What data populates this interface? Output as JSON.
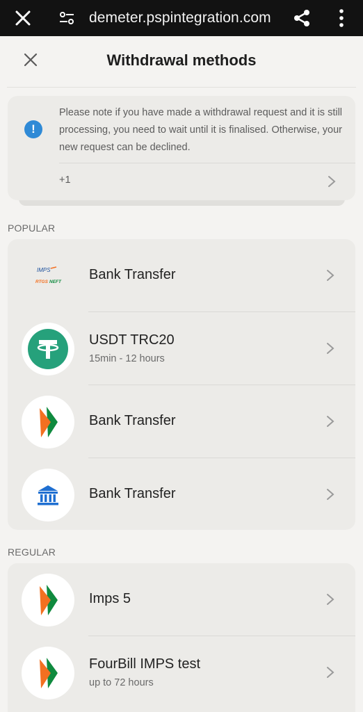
{
  "browser": {
    "url": "demeter.pspintegration.com",
    "icons": [
      "close-icon",
      "site-settings-icon",
      "share-icon",
      "more-vert-icon"
    ]
  },
  "header": {
    "title": "Withdrawal methods",
    "close_icon": "close-icon"
  },
  "notice": {
    "icon": "info-icon",
    "text": "Please note if you have made a withdrawal request and it is still processing, you need to wait until it is finalised. Otherwise, your new request can be declined.",
    "more_label": "+1"
  },
  "sections": {
    "popular_label": "POPULAR",
    "regular_label": "REGULAR"
  },
  "popular": [
    {
      "title": "Bank Transfer",
      "subtitle": "",
      "logo": "imps-neft-logo"
    },
    {
      "title": "USDT TRC20",
      "subtitle": "15min - 12 hours",
      "logo": "tether-logo"
    },
    {
      "title": "Bank Transfer",
      "subtitle": "",
      "logo": "bhim-logo"
    },
    {
      "title": "Bank Transfer",
      "subtitle": "",
      "logo": "bank-building-icon"
    }
  ],
  "regular": [
    {
      "title": "Imps 5",
      "subtitle": "",
      "logo": "bhim-logo"
    },
    {
      "title": "FourBill IMPS test",
      "subtitle": "up to 72 hours",
      "logo": "bhim-logo"
    }
  ],
  "logo_text": {
    "imps": "IMPS",
    "rtgs": "RTGS",
    "neft": "NEFT"
  },
  "colors": {
    "tether": "#26a17b",
    "info": "#2f8ad6",
    "bhim_orange": "#f37021",
    "bhim_green": "#0f8a3e",
    "bank_blue": "#1f6fd1"
  }
}
